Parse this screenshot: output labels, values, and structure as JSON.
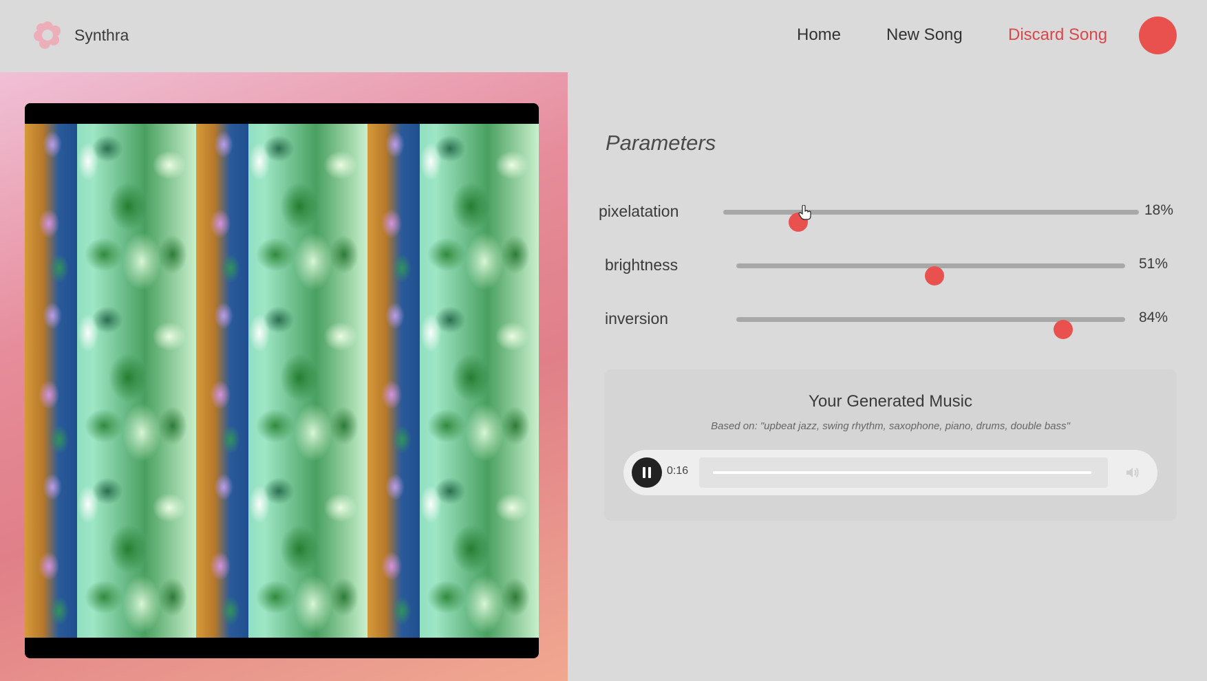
{
  "app": {
    "brand_name": "Synthra",
    "logo_icon": "flower-logo-icon"
  },
  "nav": {
    "home": "Home",
    "new_song": "New Song",
    "discard_song": "Discard Song"
  },
  "colors": {
    "accent": "#e9514f",
    "discard": "#d9474b",
    "background": "#dadada"
  },
  "parameters": {
    "title": "Parameters",
    "sliders": [
      {
        "label": "pixelatation",
        "value": 18,
        "value_text": "18%"
      },
      {
        "label": "brightness",
        "value": 51,
        "value_text": "51%"
      },
      {
        "label": "inversion",
        "value": 84,
        "value_text": "84%"
      }
    ]
  },
  "music": {
    "title": "Your Generated Music",
    "prompt": "Based on: \"upbeat jazz, swing rhythm, saxophone, piano, drums, double bass\"",
    "player": {
      "state": "playing",
      "control_icon": "pause-icon",
      "time": "0:16",
      "progress": 1.0,
      "volume_icon": "volume-icon"
    }
  }
}
